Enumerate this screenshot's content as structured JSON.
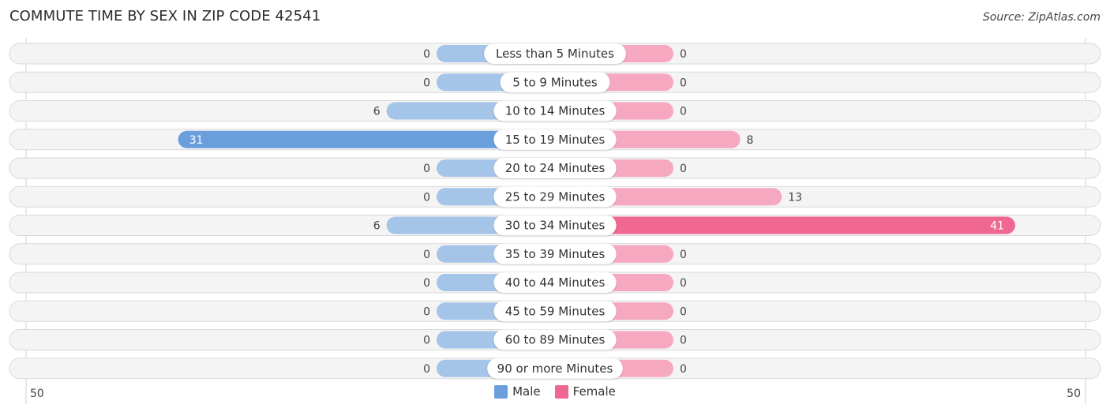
{
  "title": "COMMUTE TIME BY SEX IN ZIP CODE 42541",
  "source": "Source: ZipAtlas.com",
  "colors": {
    "male": "#a4c4e8",
    "male_strong": "#6a9fdc",
    "female": "#f6a8c0",
    "female_strong": "#f06892"
  },
  "chart_data": {
    "type": "bar",
    "orientation": "horizontal-diverging",
    "title": "COMMUTE TIME BY SEX IN ZIP CODE 42541",
    "categories": [
      "Less than 5 Minutes",
      "5 to 9 Minutes",
      "10 to 14 Minutes",
      "15 to 19 Minutes",
      "20 to 24 Minutes",
      "25 to 29 Minutes",
      "30 to 34 Minutes",
      "35 to 39 Minutes",
      "40 to 44 Minutes",
      "45 to 59 Minutes",
      "60 to 89 Minutes",
      "90 or more Minutes"
    ],
    "series": [
      {
        "name": "Male",
        "values": [
          0,
          0,
          6,
          31,
          0,
          0,
          6,
          0,
          0,
          0,
          0,
          0
        ]
      },
      {
        "name": "Female",
        "values": [
          0,
          0,
          0,
          8,
          0,
          13,
          41,
          0,
          0,
          0,
          0,
          0
        ]
      }
    ],
    "xlim": [
      -50,
      50
    ],
    "axis_labels": {
      "left": "50",
      "right": "50"
    },
    "legend": {
      "position": "bottom-center",
      "entries": [
        "Male",
        "Female"
      ]
    }
  }
}
